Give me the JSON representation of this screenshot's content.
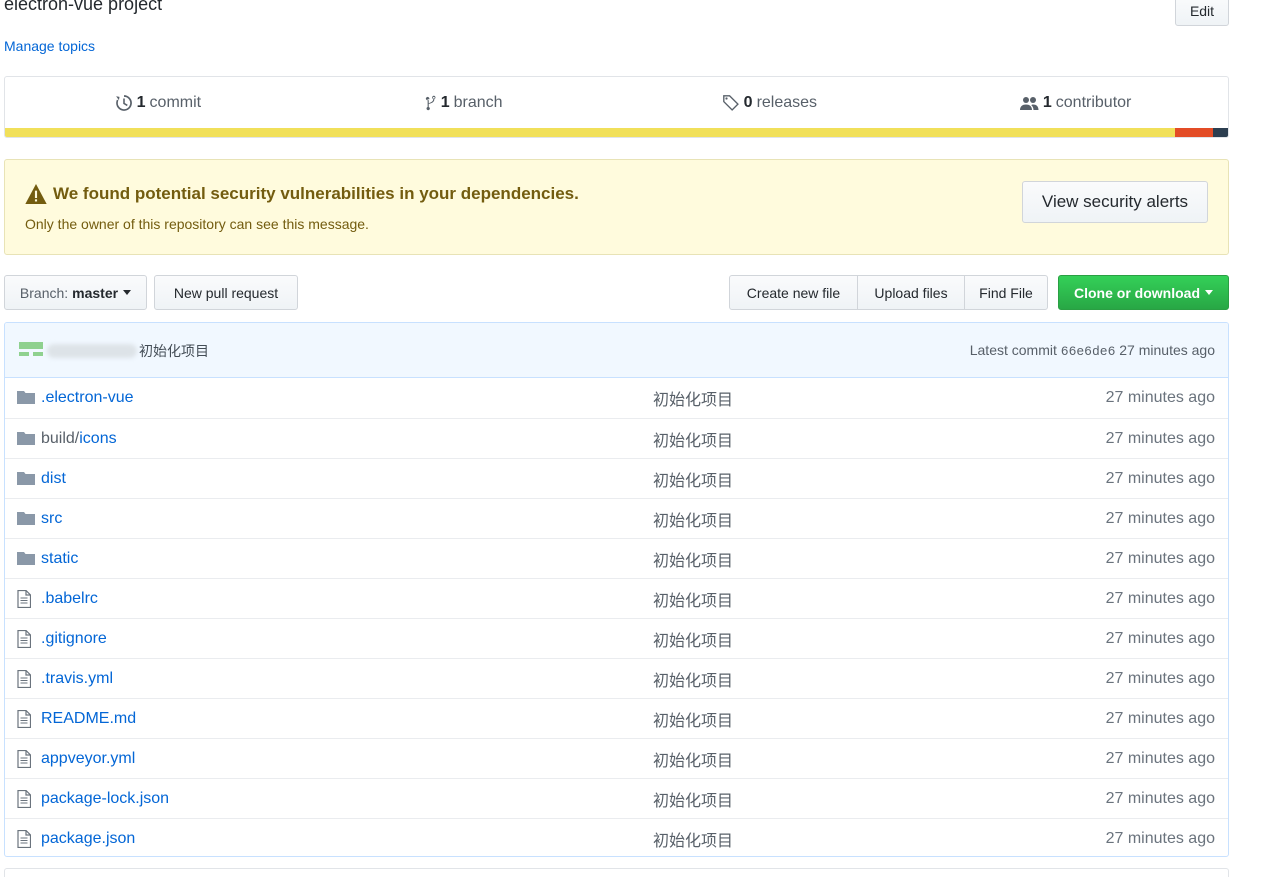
{
  "repo": {
    "description": "electron-vue project",
    "manage_topics": "Manage topics",
    "edit_label": "Edit"
  },
  "summary": {
    "commits_num": "1",
    "commits_label": "commit",
    "branches_num": "1",
    "branches_label": "branch",
    "releases_num": "0",
    "releases_label": "releases",
    "contributors_num": "1",
    "contributors_label": "contributor"
  },
  "languages": [
    {
      "color": "#f1e05a",
      "share": 0.957
    },
    {
      "color": "#e34c26",
      "share": 0.031
    },
    {
      "color": "#2c3e50",
      "share": 0.012
    }
  ],
  "alert": {
    "title": "We found potential security vulnerabilities in your dependencies.",
    "subtitle": "Only the owner of this repository can see this message.",
    "button": "View security alerts"
  },
  "toolbar": {
    "branch_label": "Branch:",
    "branch_value": "master",
    "new_pr": "New pull request",
    "create_file": "Create new file",
    "upload_files": "Upload files",
    "find_file": "Find File",
    "clone": "Clone or download"
  },
  "commit": {
    "message": "初始化项目",
    "latest_label": "Latest commit",
    "sha": "66e6de6",
    "age": "27 minutes ago"
  },
  "files": [
    {
      "type": "dir",
      "name": ".electron-vue",
      "prefix": "",
      "message": "初始化项目",
      "age": "27 minutes ago"
    },
    {
      "type": "dir",
      "name": "icons",
      "prefix": "build/",
      "message": "初始化项目",
      "age": "27 minutes ago"
    },
    {
      "type": "dir",
      "name": "dist",
      "prefix": "",
      "message": "初始化项目",
      "age": "27 minutes ago"
    },
    {
      "type": "dir",
      "name": "src",
      "prefix": "",
      "message": "初始化项目",
      "age": "27 minutes ago"
    },
    {
      "type": "dir",
      "name": "static",
      "prefix": "",
      "message": "初始化项目",
      "age": "27 minutes ago"
    },
    {
      "type": "file",
      "name": ".babelrc",
      "prefix": "",
      "message": "初始化项目",
      "age": "27 minutes ago"
    },
    {
      "type": "file",
      "name": ".gitignore",
      "prefix": "",
      "message": "初始化项目",
      "age": "27 minutes ago"
    },
    {
      "type": "file",
      "name": ".travis.yml",
      "prefix": "",
      "message": "初始化项目",
      "age": "27 minutes ago"
    },
    {
      "type": "file",
      "name": "README.md",
      "prefix": "",
      "message": "初始化项目",
      "age": "27 minutes ago"
    },
    {
      "type": "file",
      "name": "appveyor.yml",
      "prefix": "",
      "message": "初始化项目",
      "age": "27 minutes ago"
    },
    {
      "type": "file",
      "name": "package-lock.json",
      "prefix": "",
      "message": "初始化项目",
      "age": "27 minutes ago"
    },
    {
      "type": "file",
      "name": "package.json",
      "prefix": "",
      "message": "初始化项目",
      "age": "27 minutes ago"
    }
  ]
}
